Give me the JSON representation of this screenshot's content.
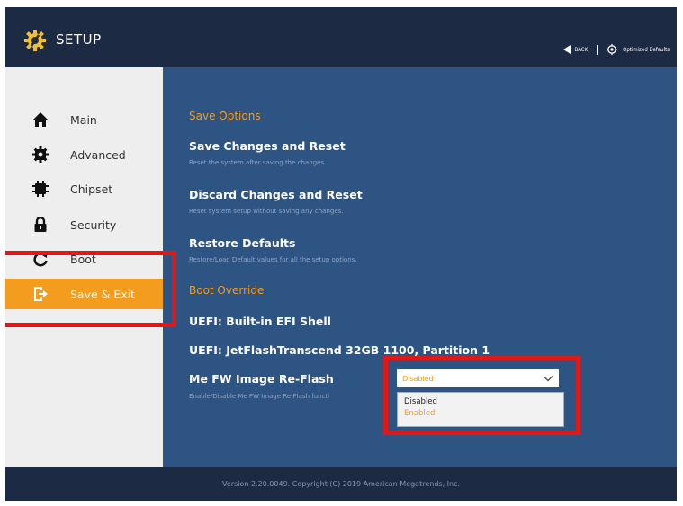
{
  "header": {
    "title": "SETUP",
    "back_label": "BACK",
    "optimized_defaults_label": "Optimized Defaults"
  },
  "sidebar": {
    "items": [
      {
        "label": "Main",
        "icon": "home-icon"
      },
      {
        "label": "Advanced",
        "icon": "gear-icon"
      },
      {
        "label": "Chipset",
        "icon": "chip-icon"
      },
      {
        "label": "Security",
        "icon": "lock-icon"
      },
      {
        "label": "Boot",
        "icon": "refresh-icon"
      },
      {
        "label": "Save & Exit",
        "icon": "exit-icon",
        "active": true
      }
    ]
  },
  "main": {
    "save_options_heading": "Save Options",
    "save_changes_reset": {
      "title": "Save Changes and Reset",
      "desc": "Reset the system after saving the changes."
    },
    "discard_changes_reset": {
      "title": "Discard Changes and Reset",
      "desc": "Reset system setup without saving any changes."
    },
    "restore_defaults": {
      "title": "Restore Defaults",
      "desc": "Restore/Load Default values for all the setup options."
    },
    "boot_override_heading": "Boot Override",
    "boot_options": [
      "UEFI: Built-in EFI Shell",
      "UEFI: JetFlashTranscend 32GB 1100, Partition 1"
    ],
    "me_fw": {
      "title": "Me FW Image Re-Flash",
      "desc": "Enable/Disable Me FW Image Re-Flash functi",
      "selected": "Disabled",
      "options": [
        "Disabled",
        "Enabled"
      ]
    }
  },
  "footer": {
    "version": "Version 2.20.0049. Copyright (C) 2019 American Megatrends, Inc."
  },
  "colors": {
    "header_bg": "#1c2a44",
    "content_bg": "#2e5484",
    "accent": "#f39c1d",
    "highlight": "#e01818"
  }
}
